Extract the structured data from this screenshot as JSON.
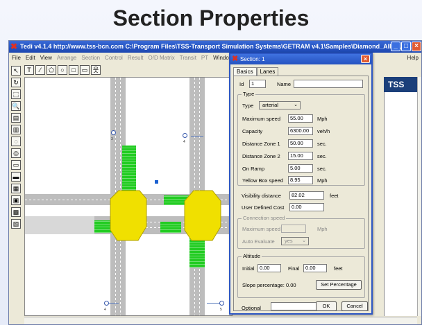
{
  "slide": {
    "title": "Section Properties"
  },
  "app": {
    "title": "Tedi v4.1.4 http://www.tss-bcn.com C:\\Program Files\\TSS-Transport Simulation Systems\\GETRAM v4.1\\Samples\\Diamond_AIMSUN_Jordi_2\\Diamon...",
    "menu": [
      "File",
      "Edit",
      "View",
      "Arrange",
      "Section",
      "Control",
      "Result",
      "O/D Matrix",
      "Transit",
      "PT",
      "Window"
    ],
    "menu_dim": [
      false,
      false,
      false,
      true,
      true,
      true,
      true,
      true,
      true,
      true,
      false
    ],
    "help": "Help",
    "brand": "TSS"
  },
  "dialog": {
    "title": "Section: 1",
    "tabs": [
      "Basics",
      "Lanes"
    ],
    "id_label": "Id",
    "id_value": "1",
    "name_label": "Name",
    "name_value": "",
    "type_group": "Type",
    "type_label": "Type",
    "type_value": "arterial",
    "max_speed_label": "Maximum speed",
    "max_speed_value": "55.00",
    "max_speed_unit": "Mph",
    "capacity_label": "Capacity",
    "capacity_value": "6300.00",
    "capacity_unit": "veh/h",
    "dz1_label": "Distance Zone 1",
    "dz1_value": "50.00",
    "dz1_unit": "sec.",
    "dz2_label": "Distance Zone 2",
    "dz2_value": "15.00",
    "dz2_unit": "sec.",
    "onramp_label": "On Ramp",
    "onramp_value": "5.00",
    "onramp_unit": "sec.",
    "ybox_label": "Yellow Box speed",
    "ybox_value": "8.95",
    "ybox_unit": "Mph",
    "visibility_label": "Visibility distance",
    "visibility_value": "82.02",
    "visibility_unit": "feet",
    "cost_label": "User Defined Cost",
    "cost_value": "0.00",
    "conn_group": "Connection speed",
    "conn_max_label": "Maximum speed",
    "conn_max_value": "",
    "conn_max_unit": "Mph",
    "auto_label": "Auto Evaluate",
    "auto_value": "yes",
    "alt_group": "Altitude",
    "initial_label": "Initial",
    "initial_value": "0.00",
    "final_label": "Final",
    "final_value": "0.00",
    "alt_unit": "feet",
    "slope_label": "Slope percentage: 0.00",
    "set_pct": "Set Percentage",
    "optional_label": "Optional",
    "optional_value": "",
    "ok": "OK",
    "cancel": "Cancel"
  },
  "nodes": [
    "3",
    "4",
    "4",
    "5"
  ]
}
